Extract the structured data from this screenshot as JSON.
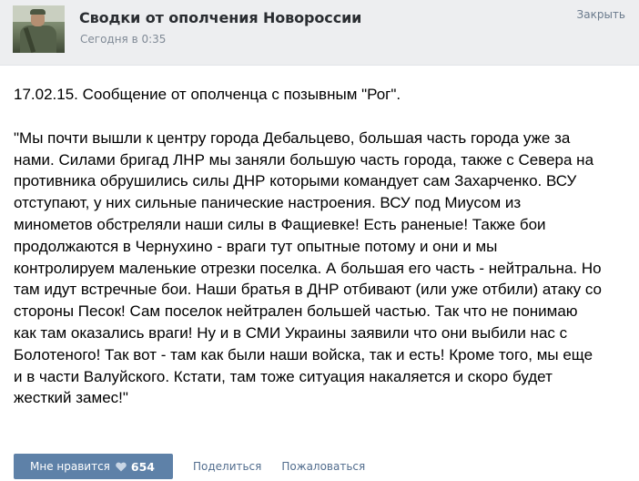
{
  "header": {
    "title": "Сводки от ополчения Новороссии",
    "timestamp": "Сегодня в 0:35",
    "close_label": "Закрыть"
  },
  "post": {
    "intro": "17.02.15. Сообщение от ополченца с позывным \"Рог\".",
    "quote_lines": [
      "\"Мы почти вышли к центру города Дебальцево, большая часть города уже за",
      "нами. Силами бригад ЛНР мы заняли большую часть города, также с Севера на",
      "противника обрушились силы ДНР которыми командует сам Захарченко. ВСУ",
      "отступают, у них сильные панические настроения. ВСУ под Миусом из",
      "минометов обстреляли наши силы в Фащиевке! Есть раненые! Также бои",
      "продолжаются в Чернухино - враги тут опытные потому и они и мы",
      "контролируем маленькие отрезки поселка. А большая его часть - нейтральна. Но",
      "там идут встречные бои. Наши братья в ДНР отбивают (или уже отбили) атаку со",
      "стороны Песок! Сам поселок нейтрален большей частью. Так что не понимаю",
      "как там оказались враги! Ну и в СМИ Украины заявили что они выбили нас с",
      "Болотеного! Так вот - там как были наши войска, так и есть! Кроме того, мы еще",
      "и в части Валуйского. Кстати, там тоже ситуация накаляется и скоро будет",
      "жесткий замес!\""
    ]
  },
  "footer": {
    "like_label": "Мне нравится",
    "like_count": "654",
    "share_label": "Поделиться",
    "report_label": "Пожаловаться"
  },
  "colors": {
    "header_bg": "#edeef0",
    "like_button_bg": "#5e81a8",
    "link": "#526d8e"
  },
  "icons": {
    "like": "heart-icon"
  }
}
